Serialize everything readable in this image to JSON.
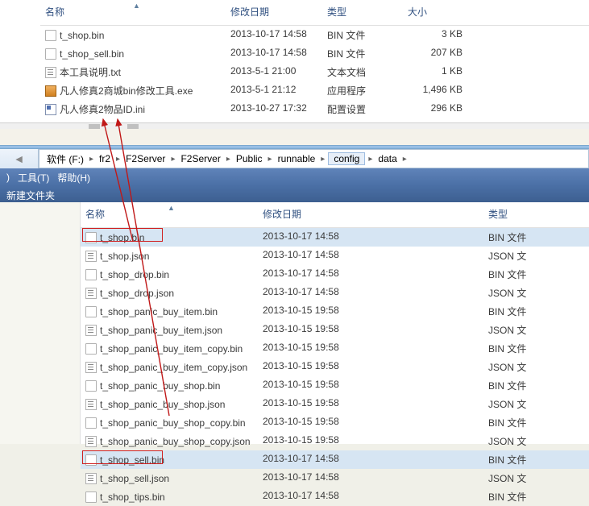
{
  "top": {
    "columns": {
      "name": "名称",
      "date": "修改日期",
      "type": "类型",
      "size": "大小"
    },
    "files": [
      {
        "name": "t_shop.bin",
        "date": "2013-10-17 14:58",
        "type": "BIN 文件",
        "size": "3 KB",
        "icon": "file"
      },
      {
        "name": "t_shop_sell.bin",
        "date": "2013-10-17 14:58",
        "type": "BIN 文件",
        "size": "207 KB",
        "icon": "file"
      },
      {
        "name": "本工具说明.txt",
        "date": "2013-5-1 21:00",
        "type": "文本文档",
        "size": "1 KB",
        "icon": "txt"
      },
      {
        "name": "凡人修真2商城bin修改工具.exe",
        "date": "2013-5-1 21:12",
        "type": "应用程序",
        "size": "1,496 KB",
        "icon": "exe"
      },
      {
        "name": "凡人修真2物品ID.ini",
        "date": "2013-10-27 17:32",
        "type": "配置设置",
        "size": "296 KB",
        "icon": "ini"
      }
    ]
  },
  "breadcrumb": {
    "items": [
      "软件 (F:)",
      "fr2",
      "F2Server",
      "F2Server",
      "Public",
      "runnable",
      "config",
      "data"
    ],
    "active_index": 6
  },
  "menubar": {
    "left_paren": ")",
    "tools": "工具(T)",
    "help": "帮助(H)"
  },
  "toolbar": {
    "new_folder": "新建文件夹"
  },
  "bottom": {
    "columns": {
      "name": "名称",
      "date": "修改日期",
      "type": "类型"
    },
    "files": [
      {
        "name": "t_shop.bin",
        "date": "2013-10-17 14:58",
        "type": "BIN 文件",
        "icon": "file",
        "selected": true,
        "boxed": true
      },
      {
        "name": "t_shop.json",
        "date": "2013-10-17 14:58",
        "type": "JSON 文",
        "icon": "txt"
      },
      {
        "name": "t_shop_drop.bin",
        "date": "2013-10-17 14:58",
        "type": "BIN 文件",
        "icon": "file"
      },
      {
        "name": "t_shop_drop.json",
        "date": "2013-10-17 14:58",
        "type": "JSON 文",
        "icon": "txt"
      },
      {
        "name": "t_shop_panic_buy_item.bin",
        "date": "2013-10-15 19:58",
        "type": "BIN 文件",
        "icon": "file"
      },
      {
        "name": "t_shop_panic_buy_item.json",
        "date": "2013-10-15 19:58",
        "type": "JSON 文",
        "icon": "txt"
      },
      {
        "name": "t_shop_panic_buy_item_copy.bin",
        "date": "2013-10-15 19:58",
        "type": "BIN 文件",
        "icon": "file"
      },
      {
        "name": "t_shop_panic_buy_item_copy.json",
        "date": "2013-10-15 19:58",
        "type": "JSON 文",
        "icon": "txt"
      },
      {
        "name": "t_shop_panic_buy_shop.bin",
        "date": "2013-10-15 19:58",
        "type": "BIN 文件",
        "icon": "file"
      },
      {
        "name": "t_shop_panic_buy_shop.json",
        "date": "2013-10-15 19:58",
        "type": "JSON 文",
        "icon": "txt"
      },
      {
        "name": "t_shop_panic_buy_shop_copy.bin",
        "date": "2013-10-15 19:58",
        "type": "BIN 文件",
        "icon": "file"
      },
      {
        "name": "t_shop_panic_buy_shop_copy.json",
        "date": "2013-10-15 19:58",
        "type": "JSON 文",
        "icon": "txt"
      },
      {
        "name": "t_shop_sell.bin",
        "date": "2013-10-17 14:58",
        "type": "BIN 文件",
        "icon": "file",
        "selected": true,
        "boxed": true
      },
      {
        "name": "t_shop_sell.json",
        "date": "2013-10-17 14:58",
        "type": "JSON 文",
        "icon": "txt"
      },
      {
        "name": "t_shop_tips.bin",
        "date": "2013-10-17 14:58",
        "type": "BIN 文件",
        "icon": "file"
      }
    ]
  }
}
